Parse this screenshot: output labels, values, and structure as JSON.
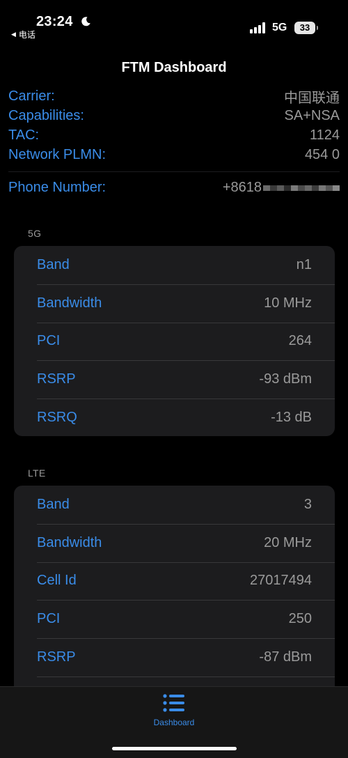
{
  "status_bar": {
    "time": "23:24",
    "back_app": "电话",
    "network_type": "5G",
    "battery": "33"
  },
  "header": {
    "title": "FTM Dashboard"
  },
  "info": {
    "rows": [
      {
        "label": "Carrier:",
        "value": "中国联通"
      },
      {
        "label": "Capabilities:",
        "value": "SA+NSA"
      },
      {
        "label": "TAC:",
        "value": "1124"
      },
      {
        "label": "Network PLMN:",
        "value": "454 0"
      }
    ],
    "phone": {
      "label": "Phone Number:",
      "value": "+8618"
    }
  },
  "nr": {
    "header": "5G",
    "rows": [
      {
        "label": "Band",
        "value": "n1"
      },
      {
        "label": "Bandwidth",
        "value": "10 MHz"
      },
      {
        "label": "PCI",
        "value": "264"
      },
      {
        "label": "RSRP",
        "value": "-93 dBm"
      },
      {
        "label": "RSRQ",
        "value": "-13 dB"
      }
    ]
  },
  "lte": {
    "header": "LTE",
    "rows": [
      {
        "label": "Band",
        "value": "3"
      },
      {
        "label": "Bandwidth",
        "value": "20 MHz"
      },
      {
        "label": "Cell Id",
        "value": "27017494"
      },
      {
        "label": "PCI",
        "value": "250"
      },
      {
        "label": "RSRP",
        "value": "-87 dBm"
      }
    ]
  },
  "tab_bar": {
    "dashboard_label": "Dashboard"
  },
  "colors": {
    "accent": "#3a8ce8",
    "card": "#1c1c1e",
    "secondary_text": "#9a9a9a"
  },
  "icons": {
    "moon": "moon-icon",
    "signal": "cellular-signal-icon",
    "tab": "list-icon"
  }
}
